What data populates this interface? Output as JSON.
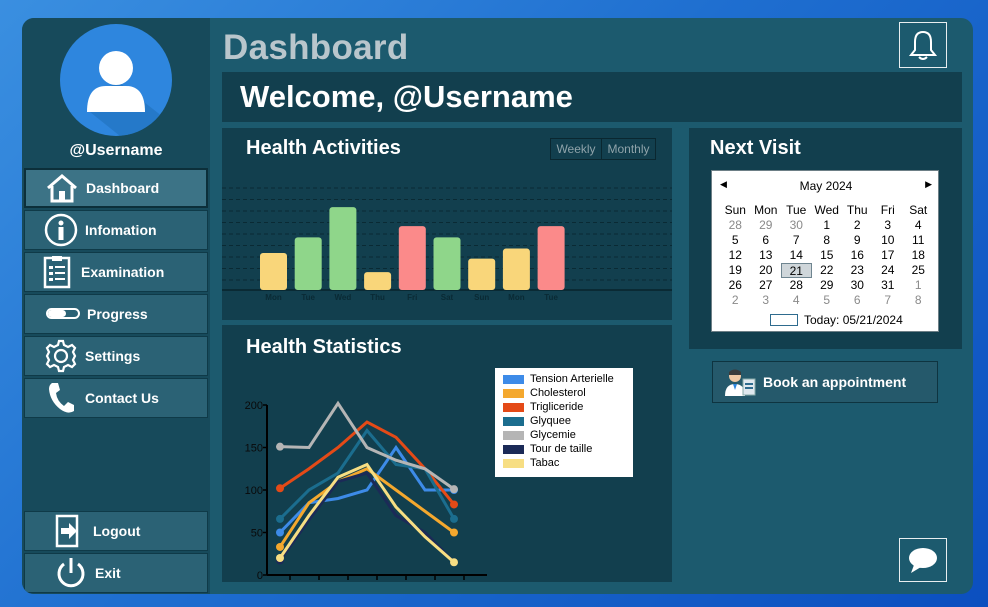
{
  "sidebar": {
    "username": "@Username",
    "items": [
      {
        "label": "Dashboard",
        "icon": "home-icon"
      },
      {
        "label": "Infomation",
        "icon": "info-icon"
      },
      {
        "label": "Examination",
        "icon": "clipboard-icon"
      },
      {
        "label": "Progress",
        "icon": "progress-bar-icon"
      },
      {
        "label": "Settings",
        "icon": "gear-icon"
      },
      {
        "label": "Contact Us",
        "icon": "phone-icon"
      }
    ],
    "logout_label": "Logout",
    "exit_label": "Exit"
  },
  "header": {
    "title": "Dashboard",
    "welcome": "Welcome, @Username"
  },
  "health_activities": {
    "title": "Health Activities",
    "toggle_weekly": "Weekly",
    "toggle_monthly": "Monthly"
  },
  "health_statistics": {
    "title": "Health Statistics"
  },
  "next_visit": {
    "title": "Next Visit",
    "month_label": "May 2024",
    "weekdays": [
      "Sun",
      "Mon",
      "Tue",
      "Wed",
      "Thu",
      "Fri",
      "Sat"
    ],
    "weeks": [
      [
        "28",
        "29",
        "30",
        "1",
        "2",
        "3",
        "4"
      ],
      [
        "5",
        "6",
        "7",
        "8",
        "9",
        "10",
        "11"
      ],
      [
        "12",
        "13",
        "14",
        "15",
        "16",
        "17",
        "18"
      ],
      [
        "19",
        "20",
        "21",
        "22",
        "23",
        "24",
        "25"
      ],
      [
        "26",
        "27",
        "28",
        "29",
        "30",
        "31",
        "1"
      ],
      [
        "2",
        "3",
        "4",
        "5",
        "6",
        "7",
        "8"
      ]
    ],
    "selected_day": "21",
    "today_label": "Today: 05/21/2024"
  },
  "book_label": "Book an appointment",
  "colors": {
    "window": "#1c5a6e",
    "panel": "#123f4e",
    "bar_yellow": "#f9d67a",
    "bar_green": "#8fd68a",
    "bar_red": "#fb8a8a"
  },
  "chart_data": [
    {
      "type": "bar",
      "title": "Health Activities",
      "categories": [
        "Mon",
        "Tue",
        "Wed",
        "Thu",
        "Fri",
        "Sat",
        "Sun",
        "Mon",
        "Tue"
      ],
      "values": [
        33,
        47,
        74,
        16,
        57,
        47,
        28,
        37,
        57
      ],
      "bar_colors": [
        "#f9d67a",
        "#8fd68a",
        "#8fd68a",
        "#f9d67a",
        "#fb8a8a",
        "#8fd68a",
        "#f9d67a",
        "#f9d67a",
        "#fb8a8a"
      ],
      "ylim": [
        0,
        100
      ],
      "grid": true
    },
    {
      "type": "line",
      "title": "Health Statistics",
      "ylim": [
        0,
        200
      ],
      "yticks": [
        "0",
        "50",
        "100",
        "150",
        "200"
      ],
      "x": [
        1,
        2,
        3,
        4,
        5,
        6,
        7
      ],
      "series": [
        {
          "name": "Tension Arterielle",
          "color": "#3d8be8",
          "values": [
            50,
            85,
            90,
            100,
            150,
            100,
            100
          ]
        },
        {
          "name": "Cholesterol",
          "color": "#f4a82e",
          "values": [
            33,
            85,
            110,
            125,
            100,
            75,
            50
          ]
        },
        {
          "name": "Trigliceride",
          "color": "#e44a17",
          "values": [
            102,
            125,
            150,
            180,
            162,
            125,
            83
          ]
        },
        {
          "name": "Glyquee",
          "color": "#1b6d8e",
          "values": [
            66,
            100,
            120,
            170,
            130,
            125,
            66
          ]
        },
        {
          "name": "Glycemie",
          "color": "#b5b5b5",
          "values": [
            151,
            150,
            202,
            150,
            135,
            125,
            101
          ]
        },
        {
          "name": "Tour de taille",
          "color": "#1b2a57",
          "values": [
            17,
            65,
            110,
            120,
            70,
            50,
            15
          ]
        },
        {
          "name": "Tabac",
          "color": "#f7de83",
          "values": [
            20,
            70,
            115,
            130,
            80,
            45,
            15
          ]
        }
      ]
    }
  ]
}
